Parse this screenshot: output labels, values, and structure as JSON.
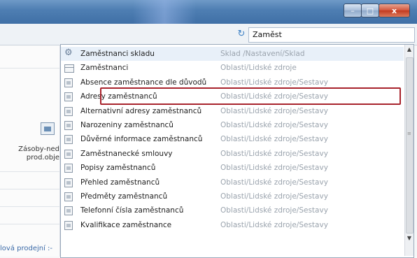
{
  "window": {
    "min_icon": "minimize-icon",
    "max_icon": "maximize-icon",
    "close_label": "x"
  },
  "search": {
    "value": "Zaměst",
    "refresh_icon": "refresh-icon"
  },
  "background": {
    "text1": "Zásoby-ned",
    "text2": "prod.obje",
    "bottom_link": "lová prodejní :-"
  },
  "results": [
    {
      "icon": "gear",
      "name": "Zaměstnanci skladu",
      "path": "Sklad /Nastavení/Sklad"
    },
    {
      "icon": "grid",
      "name": "Zaměstnanci",
      "path": "Oblasti/Lidské zdroje"
    },
    {
      "icon": "doc",
      "name": "Absence zaměstnance dle důvodů",
      "path": "Oblasti/Lidské zdroje/Sestavy"
    },
    {
      "icon": "doc",
      "name": "Adresy zaměstnanců",
      "path": "Oblasti/Lidské zdroje/Sestavy"
    },
    {
      "icon": "doc",
      "name": "Alternativní adresy zaměstnanců",
      "path": "Oblasti/Lidské zdroje/Sestavy"
    },
    {
      "icon": "doc",
      "name": "Narozeniny zaměstnanců",
      "path": "Oblasti/Lidské zdroje/Sestavy"
    },
    {
      "icon": "doc",
      "name": "Důvěrné informace zaměstnanců",
      "path": "Oblasti/Lidské zdroje/Sestavy"
    },
    {
      "icon": "doc",
      "name": "Zaměstnanecké smlouvy",
      "path": "Oblasti/Lidské zdroje/Sestavy"
    },
    {
      "icon": "doc",
      "name": "Popisy zaměstnanců",
      "path": "Oblasti/Lidské zdroje/Sestavy"
    },
    {
      "icon": "doc",
      "name": "Přehled zaměstnanců",
      "path": "Oblasti/Lidské zdroje/Sestavy"
    },
    {
      "icon": "doc",
      "name": "Předměty zaměstnanců",
      "path": "Oblasti/Lidské zdroje/Sestavy"
    },
    {
      "icon": "doc",
      "name": "Telefonní čísla zaměstnanců",
      "path": "Oblasti/Lidské zdroje/Sestavy"
    },
    {
      "icon": "doc",
      "name": "Kvalifikace zaměstnance",
      "path": "Oblasti/Lidské zdroje/Sestavy"
    }
  ],
  "colors": {
    "highlight_border": "#a8232c",
    "highlight_bg": "#e8f0f9",
    "path_text": "#9aa3ad"
  }
}
